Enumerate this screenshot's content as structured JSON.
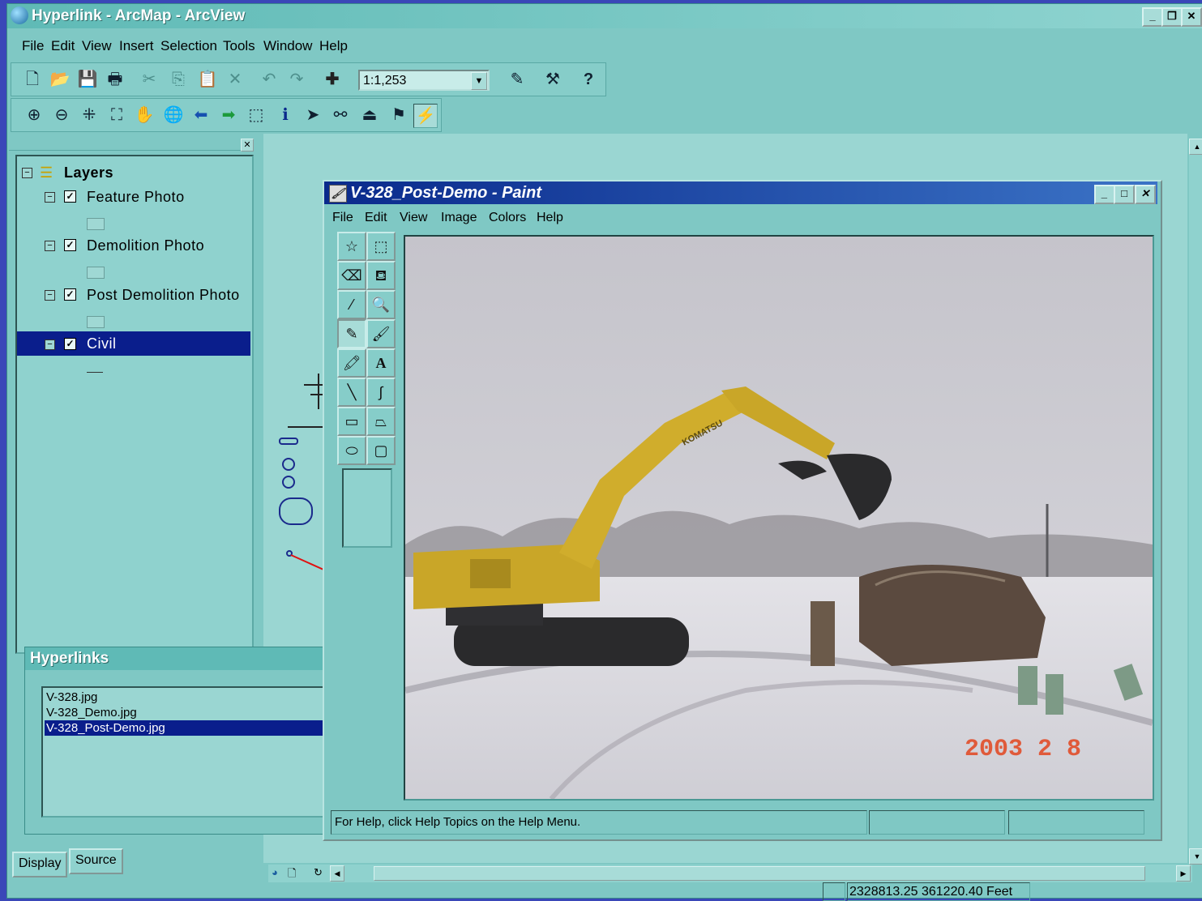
{
  "app": {
    "title": "Hyperlink - ArcMap - ArcView"
  },
  "menu": [
    "File",
    "Edit",
    "View",
    "Insert",
    "Selection",
    "Tools",
    "Window",
    "Help"
  ],
  "toolbar": {
    "scale": "1:1,253"
  },
  "toc": {
    "root": "Layers",
    "layers": [
      {
        "name": "Feature Photo",
        "checked": true,
        "selected": false
      },
      {
        "name": "Demolition Photo",
        "checked": true,
        "selected": false
      },
      {
        "name": "Post Demolition Photo",
        "checked": true,
        "selected": false
      },
      {
        "name": "Civil",
        "checked": true,
        "selected": true
      }
    ],
    "tabs": {
      "display": "Display",
      "source": "Source"
    }
  },
  "hyperlinks": {
    "title": "Hyperlinks",
    "items": [
      "V-328.jpg",
      "V-328_Demo.jpg",
      "V-328_Post-Demo.jpg"
    ],
    "selected_index": 2
  },
  "paint": {
    "title": "V-328_Post-Demo - Paint",
    "menu": [
      "File",
      "Edit",
      "View",
      "Image",
      "Colors",
      "Help"
    ],
    "status": "For Help, click Help Topics on the Help Menu.",
    "photo_stamp": "2003  2  8",
    "photo_brand": "KOMATSU"
  },
  "status_bar": {
    "coords": "2328813.25  361220.40 Feet"
  },
  "colors": {
    "accent": "#0a1e8c",
    "window": "#7fc8c4",
    "desktop": "#3a47b8"
  }
}
